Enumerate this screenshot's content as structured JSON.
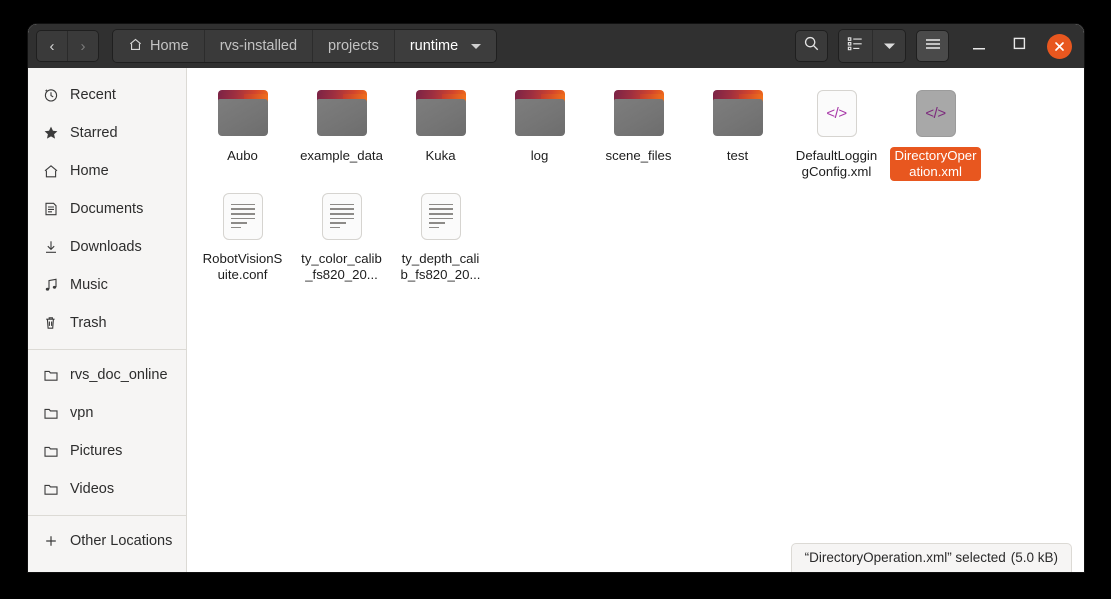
{
  "window": {
    "title": "runtime",
    "nav": {
      "back_label": "‹",
      "forward_label": "›",
      "back_name": "back-button",
      "forward_name": "forward-button"
    },
    "breadcrumbs": [
      {
        "label": "Home",
        "icon": "home-icon",
        "active": false
      },
      {
        "label": "rvs-installed",
        "icon": "",
        "active": false
      },
      {
        "label": "projects",
        "icon": "",
        "active": false
      },
      {
        "label": "runtime",
        "icon": "",
        "active": true,
        "caret": true
      }
    ],
    "toolbar": {
      "search_label": "search-icon",
      "view_list_label": "view-list-icon",
      "view_dropdown_label": "view-options-dropdown-icon",
      "menu_label": "hamburger-menu-icon"
    },
    "controls": {
      "minimize_label": "–",
      "maximize_label": "□",
      "close_label": "✕",
      "close_color": "#e8571f"
    }
  },
  "sidebar": {
    "groups": [
      {
        "items": [
          {
            "label": "Recent",
            "icon": "clock-icon"
          },
          {
            "label": "Starred",
            "icon": "star-icon"
          },
          {
            "label": "Home",
            "icon": "home-icon"
          },
          {
            "label": "Documents",
            "icon": "documents-icon"
          },
          {
            "label": "Downloads",
            "icon": "downloads-icon"
          },
          {
            "label": "Music",
            "icon": "music-icon"
          },
          {
            "label": "Trash",
            "icon": "trash-icon"
          }
        ]
      },
      {
        "items": [
          {
            "label": "rvs_doc_online",
            "icon": "folder-icon"
          },
          {
            "label": "vpn",
            "icon": "folder-icon"
          },
          {
            "label": "Pictures",
            "icon": "folder-icon"
          },
          {
            "label": "Videos",
            "icon": "folder-icon"
          }
        ]
      },
      {
        "items": [
          {
            "label": "Other Locations",
            "icon": "plus-icon"
          }
        ]
      }
    ]
  },
  "files": [
    {
      "name": "Aubo",
      "type": "folder",
      "selected": false
    },
    {
      "name": "example_data",
      "type": "folder",
      "selected": false
    },
    {
      "name": "Kuka",
      "type": "folder",
      "selected": false
    },
    {
      "name": "log",
      "type": "folder",
      "selected": false
    },
    {
      "name": "scene_files",
      "type": "folder",
      "selected": false
    },
    {
      "name": "test",
      "type": "folder",
      "selected": false
    },
    {
      "name": "DefaultLoggingConfig.xml",
      "type": "xml",
      "selected": false
    },
    {
      "name": "DirectoryOperation.xml",
      "type": "xml",
      "selected": true
    },
    {
      "name": "RobotVisionSuite.conf",
      "type": "text",
      "selected": false
    },
    {
      "name": "ty_color_calib_fs820_20...",
      "type": "text",
      "selected": false
    },
    {
      "name": "ty_depth_calib_fs820_20...",
      "type": "text",
      "selected": false
    }
  ],
  "statusbar": {
    "text": "“DirectoryOperation.xml” selected",
    "size": "(5.0 kB)"
  },
  "colors": {
    "accent_orange": "#e8571f",
    "header_bg": "#303030",
    "sidebar_bg": "#f6f5f4",
    "xml_glyph": "#a839a8"
  }
}
